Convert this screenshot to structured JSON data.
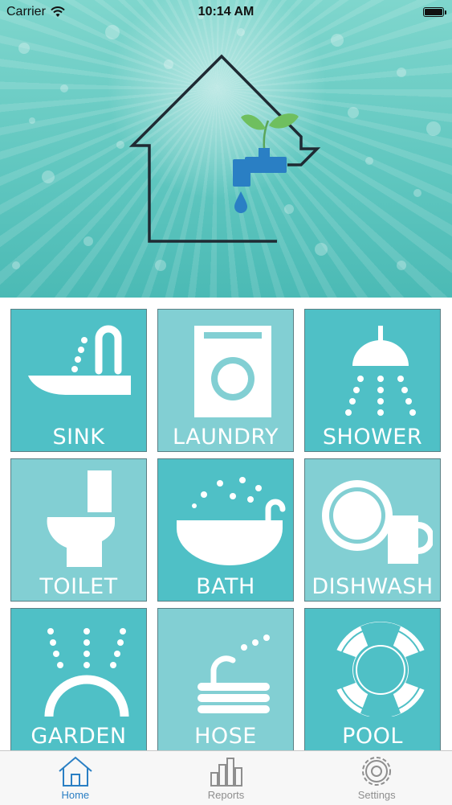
{
  "status_bar": {
    "carrier": "Carrier",
    "time": "10:14 AM"
  },
  "tiles": [
    {
      "label": "SINK",
      "icon": "sink-icon"
    },
    {
      "label": "LAUNDRY",
      "icon": "washing-machine-icon"
    },
    {
      "label": "SHOWER",
      "icon": "shower-icon"
    },
    {
      "label": "TOILET",
      "icon": "toilet-icon"
    },
    {
      "label": "BATH",
      "icon": "bathtub-icon"
    },
    {
      "label": "DISHWASH",
      "icon": "dishes-icon"
    },
    {
      "label": "GARDEN",
      "icon": "sprinkler-icon"
    },
    {
      "label": "HOSE",
      "icon": "hose-icon"
    },
    {
      "label": "POOL",
      "icon": "lifebuoy-icon"
    }
  ],
  "tab_bar": {
    "items": [
      {
        "label": "Home",
        "icon": "home-icon",
        "active": true
      },
      {
        "label": "Reports",
        "icon": "bar-chart-icon",
        "active": false
      },
      {
        "label": "Settings",
        "icon": "gear-icon",
        "active": false
      }
    ]
  },
  "colors": {
    "tile_dark": "#4fc0c6",
    "tile_light": "#82cfd3",
    "tab_active": "#2a7fc4",
    "tab_inactive": "#8e8e8e"
  }
}
